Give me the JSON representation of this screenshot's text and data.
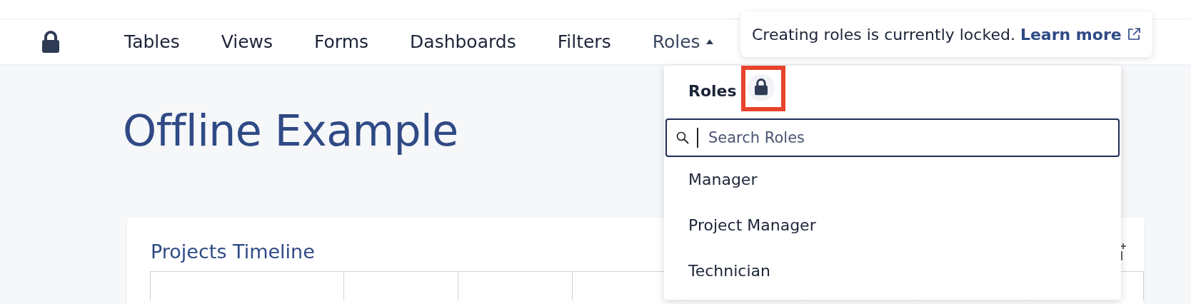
{
  "nav": {
    "items": [
      {
        "label": "Tables",
        "selected": false
      },
      {
        "label": "Views",
        "selected": false
      },
      {
        "label": "Forms",
        "selected": false
      },
      {
        "label": "Dashboards",
        "selected": false
      },
      {
        "label": "Filters",
        "selected": false
      },
      {
        "label": "Roles",
        "selected": true
      }
    ]
  },
  "page": {
    "title": "Offline Example"
  },
  "card": {
    "title": "Projects Timeline"
  },
  "tooltip": {
    "text": "Creating roles is currently locked.",
    "link": "Learn more"
  },
  "dropdown": {
    "title": "Roles",
    "search": {
      "placeholder": "Search Roles"
    },
    "items": [
      "Manager",
      "Project Manager",
      "Technician"
    ]
  }
}
